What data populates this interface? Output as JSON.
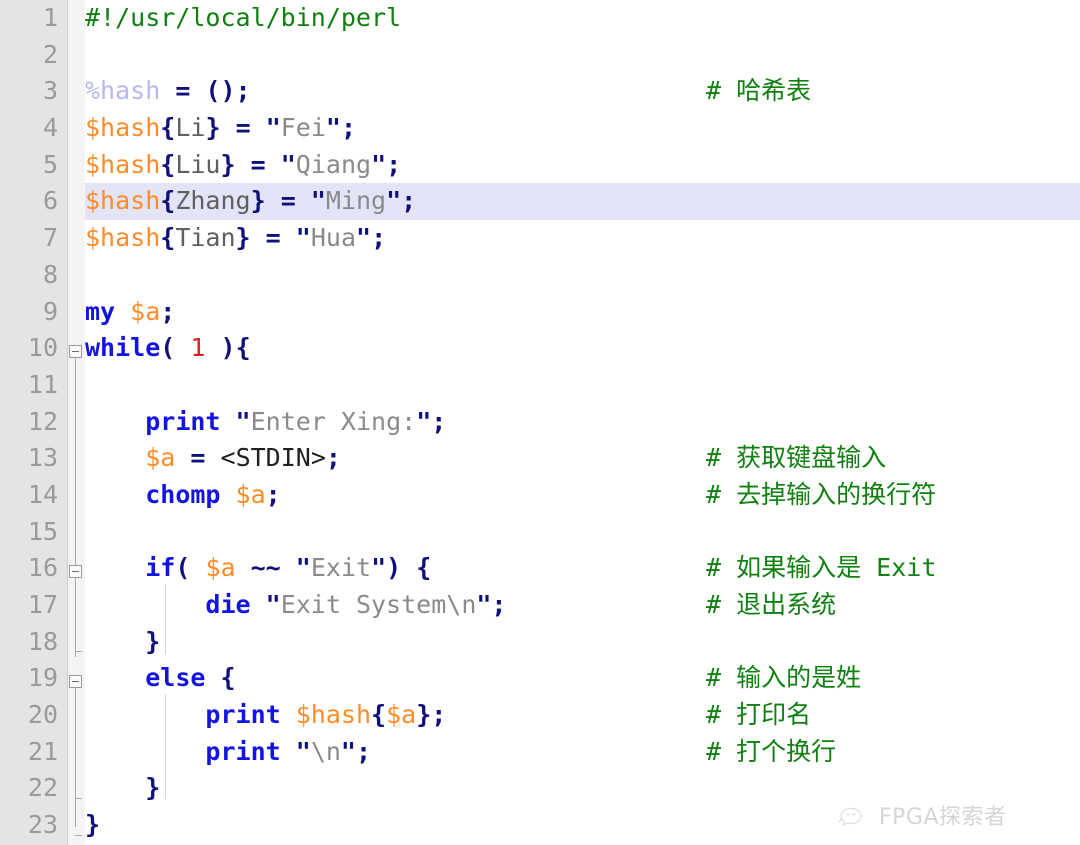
{
  "editor": {
    "language": "perl",
    "current_line": 6,
    "total_lines": 23,
    "colors": {
      "background": "#ffffff",
      "gutter": "#e4e4e4",
      "fold_margin": "#f4f4f4",
      "current_line_highlight": "#e4e4f8",
      "line_number": "#9a9a9a",
      "keyword": "#1414e0",
      "variable": "#ff8c28",
      "hash_variable": "#b8b8f0",
      "operator": "#10107a",
      "string": "#8a8a8a",
      "number": "#d92020",
      "comment": "#108010"
    }
  },
  "lines": [
    {
      "n": "1",
      "code_html": "<span class=\"cmt\">#!/usr/local/bin/perl</span>",
      "comment_html": ""
    },
    {
      "n": "2",
      "code_html": "",
      "comment_html": ""
    },
    {
      "n": "3",
      "code_html": "<span class=\"hvar\">%hash</span> <span class=\"op\">=</span> <span class=\"op\">();</span>",
      "comment_html": "<span class=\"cmt\"># </span><span class=\"cmt cjk\">哈希表</span>"
    },
    {
      "n": "4",
      "code_html": "<span class=\"var\">$hash</span><span class=\"op\">{</span><span class=\"key\">Li</span><span class=\"op\">}</span> <span class=\"op\">=</span> <span class=\"op\">\"</span><span class=\"str\">Fei</span><span class=\"op\">\";</span>",
      "comment_html": ""
    },
    {
      "n": "5",
      "code_html": "<span class=\"var\">$hash</span><span class=\"op\">{</span><span class=\"key\">Liu</span><span class=\"op\">}</span> <span class=\"op\">=</span> <span class=\"op\">\"</span><span class=\"str\">Qiang</span><span class=\"op\">\";</span>",
      "comment_html": ""
    },
    {
      "n": "6",
      "code_html": "<span class=\"var\">$hash</span><span class=\"op\">{</span><span class=\"key\">Zhang</span><span class=\"op\">}</span> <span class=\"op\">=</span> <span class=\"op\">\"</span><span class=\"str\">Ming</span><span class=\"op\">\";</span>",
      "comment_html": ""
    },
    {
      "n": "7",
      "code_html": "<span class=\"var\">$hash</span><span class=\"op\">{</span><span class=\"key\">Tian</span><span class=\"op\">}</span> <span class=\"op\">=</span> <span class=\"op\">\"</span><span class=\"str\">Hua</span><span class=\"op\">\";</span>",
      "comment_html": ""
    },
    {
      "n": "8",
      "code_html": "",
      "comment_html": ""
    },
    {
      "n": "9",
      "code_html": "<span class=\"kw\">my</span> <span class=\"var\">$a</span><span class=\"op\">;</span>",
      "comment_html": ""
    },
    {
      "n": "10",
      "code_html": "<span class=\"kw\">while</span><span class=\"op\">(</span> <span class=\"num\">1</span> <span class=\"op\">){</span>",
      "comment_html": ""
    },
    {
      "n": "11",
      "code_html": "",
      "comment_html": ""
    },
    {
      "n": "12",
      "code_html": "    <span class=\"kw\">print</span> <span class=\"op\">\"</span><span class=\"str\">Enter Xing:</span><span class=\"op\">\";</span>",
      "comment_html": ""
    },
    {
      "n": "13",
      "code_html": "    <span class=\"var\">$a</span> <span class=\"op\">=</span> <span class=\"plain\">&lt;STDIN&gt;</span><span class=\"op\">;</span>",
      "comment_html": "<span class=\"cmt\"># </span><span class=\"cmt cjk\">获取键盘输入</span>"
    },
    {
      "n": "14",
      "code_html": "    <span class=\"kw\">chomp</span> <span class=\"var\">$a</span><span class=\"op\">;</span>",
      "comment_html": "<span class=\"cmt\"># </span><span class=\"cmt cjk\">去掉输入的换行符</span>"
    },
    {
      "n": "15",
      "code_html": "",
      "comment_html": ""
    },
    {
      "n": "16",
      "code_html": "    <span class=\"kw\">if</span><span class=\"op\">(</span> <span class=\"var\">$a</span> <span class=\"op\">~~</span> <span class=\"op\">\"</span><span class=\"str\">Exit</span><span class=\"op\">\")</span> <span class=\"op\">{</span>",
      "comment_html": "<span class=\"cmt\"># </span><span class=\"cmt cjk\">如果输入是</span><span class=\"cmt\"> Exit</span>"
    },
    {
      "n": "17",
      "code_html": "        <span class=\"kw\">die</span> <span class=\"op\">\"</span><span class=\"str\">Exit System\\n</span><span class=\"op\">\";</span>",
      "comment_html": "<span class=\"cmt\"># </span><span class=\"cmt cjk\">退出系统</span>"
    },
    {
      "n": "18",
      "code_html": "    <span class=\"op\">}</span>",
      "comment_html": ""
    },
    {
      "n": "19",
      "code_html": "    <span class=\"kw\">else</span> <span class=\"op\">{</span>",
      "comment_html": "<span class=\"cmt\"># </span><span class=\"cmt cjk\">输入的是姓</span>"
    },
    {
      "n": "20",
      "code_html": "        <span class=\"kw\">print</span> <span class=\"var\">$hash</span><span class=\"op\">{</span><span class=\"var\">$a</span><span class=\"op\">};</span>",
      "comment_html": "<span class=\"cmt\"># </span><span class=\"cmt cjk\">打印名</span>"
    },
    {
      "n": "21",
      "code_html": "        <span class=\"kw\">print</span> <span class=\"op\">\"</span><span class=\"str\">\\n</span><span class=\"op\">\";</span>",
      "comment_html": "<span class=\"cmt\"># </span><span class=\"cmt cjk\">打个换行</span>"
    },
    {
      "n": "22",
      "code_html": "    <span class=\"op\">}</span>",
      "comment_html": ""
    },
    {
      "n": "23",
      "code_html": "<span class=\"op\">}</span>",
      "comment_html": ""
    }
  ],
  "lines_plain": [
    "#!/usr/local/bin/perl",
    "",
    "%hash = ();                          # 哈希表",
    "$hash{Li} = \"Fei\";",
    "$hash{Liu} = \"Qiang\";",
    "$hash{Zhang} = \"Ming\";",
    "$hash{Tian} = \"Hua\";",
    "",
    "my $a;",
    "while( 1 ){",
    "",
    "    print \"Enter Xing:\";",
    "    $a = <STDIN>;                     # 获取键盘输入",
    "    chomp $a;                         # 去掉输入的换行符",
    "",
    "    if( $a ~~ \"Exit\") {               # 如果输入是 Exit",
    "        die \"Exit System\\n\";          # 退出系统",
    "    }",
    "    else {                            # 输入的是姓",
    "        print $hash{$a};              # 打印名",
    "        print \"\\n\";                   # 打个换行",
    "    }",
    "}"
  ],
  "fold_markers": [
    {
      "line": 10,
      "type": "open"
    },
    {
      "line": 16,
      "type": "open"
    },
    {
      "line": 19,
      "type": "open"
    },
    {
      "line": 18,
      "type": "end"
    },
    {
      "line": 22,
      "type": "end"
    },
    {
      "line": 23,
      "type": "end"
    }
  ],
  "watermark": {
    "text": "FPGA探索者",
    "icon": "wechat-bubble-icon"
  }
}
